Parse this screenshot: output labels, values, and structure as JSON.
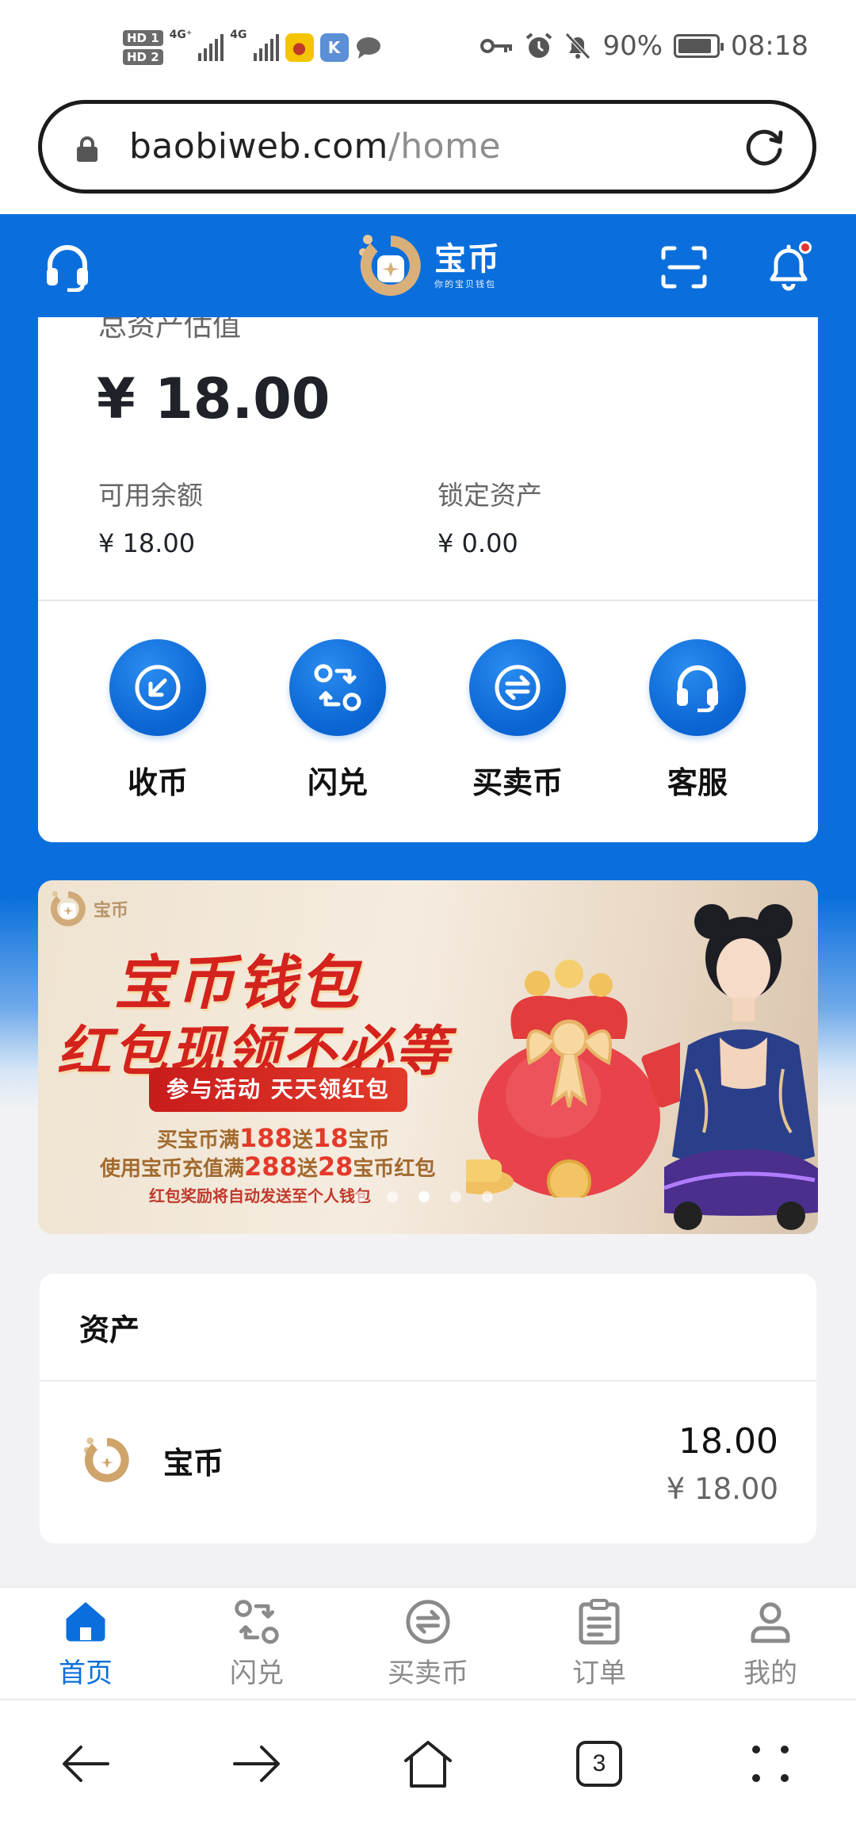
{
  "status_bar": {
    "sim1": "HD 1",
    "sim2": "HD 2",
    "network1": "4G⁺",
    "network2": "4G",
    "battery_percent": "90%",
    "battery_level": 0.9,
    "time": "08:18"
  },
  "url_bar": {
    "domain": "baobiweb.com",
    "path": "/home"
  },
  "header": {
    "logo_title": "宝币",
    "logo_subtitle": "你的宝贝钱包",
    "notification_dot": true
  },
  "asset_card": {
    "label": "总资产估值",
    "total": "¥ 18.00",
    "available_label": "可用余额",
    "available_value": "¥ 18.00",
    "locked_label": "锁定资产",
    "locked_value": "¥ 0.00"
  },
  "actions": [
    {
      "label": "收币",
      "icon": "receive-icon"
    },
    {
      "label": "闪兑",
      "icon": "swap-icon"
    },
    {
      "label": "买卖币",
      "icon": "exchange-icon"
    },
    {
      "label": "客服",
      "icon": "headset-icon"
    }
  ],
  "banner": {
    "brand": "宝币",
    "title_line1": "宝币钱包",
    "title_line2": "红包现领不必等",
    "pill": "参与活动 天天领红包",
    "line1_prefix": "买宝币满",
    "line1_n1": "188",
    "line1_mid": "送",
    "line1_n2": "18",
    "line1_suffix": "宝币",
    "line2_prefix": "使用宝币充值满",
    "line2_n1": "288",
    "line2_mid": "送",
    "line2_n2": "28",
    "line2_suffix": "宝币红包",
    "line3": "红包奖励将自动发送至个人钱包",
    "slide_count": 5,
    "active_slide": 3
  },
  "assets": {
    "title": "资产",
    "rows": [
      {
        "name": "宝币",
        "amount": "18.00",
        "value": "¥ 18.00"
      }
    ]
  },
  "bottom_nav": [
    {
      "label": "首页",
      "icon": "home-icon",
      "active": true
    },
    {
      "label": "闪兑",
      "icon": "swap-icon",
      "active": false
    },
    {
      "label": "买卖币",
      "icon": "exchange-icon",
      "active": false
    },
    {
      "label": "订单",
      "icon": "clipboard-icon",
      "active": false
    },
    {
      "label": "我的",
      "icon": "user-icon",
      "active": false
    }
  ],
  "browser_bar": {
    "tabs_count": "3"
  },
  "colors": {
    "brand_blue": "#0a6fdc",
    "banner_red": "#d4221d",
    "gold": "#c9a06a"
  }
}
